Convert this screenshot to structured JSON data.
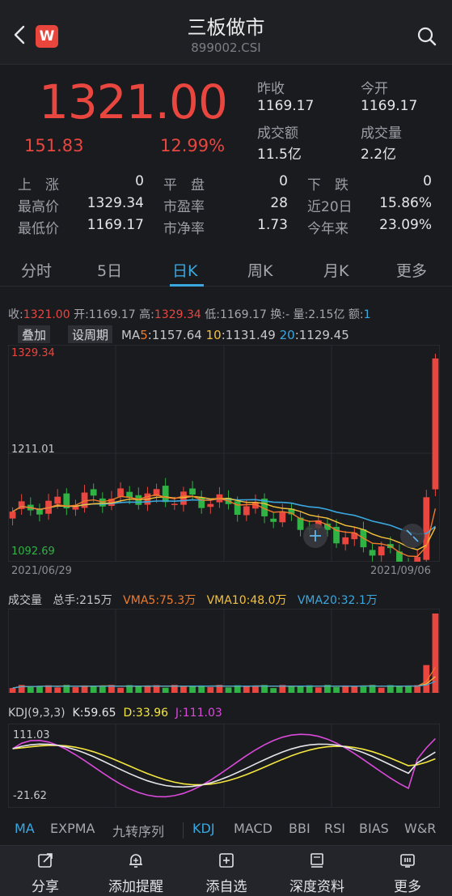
{
  "header": {
    "title": "三板做市",
    "code": "899002.CSI",
    "logo_letter": "W"
  },
  "quote": {
    "price": "1321.00",
    "change": "151.83",
    "change_pct": "12.99%",
    "prev_close_label": "昨收",
    "prev_close": "1169.17",
    "open_label": "今开",
    "open": "1169.17",
    "turnover_label": "成交额",
    "turnover": "11.5亿",
    "volume_label": "成交量",
    "volume": "2.2亿"
  },
  "stats": {
    "up_label": "上　涨",
    "up": "0",
    "flat_label": "平　盘",
    "flat": "0",
    "down_label": "下　跌",
    "down": "0",
    "high_label": "最高价",
    "high": "1329.34",
    "pe_label": "市盈率",
    "pe": "28",
    "d20_label": "近20日",
    "d20": "15.86%",
    "low_label": "最低价",
    "low": "1169.17",
    "pb_label": "市净率",
    "pb": "1.73",
    "ytd_label": "今年来",
    "ytd": "23.09%"
  },
  "tabs": [
    "分时",
    "5日",
    "日K",
    "周K",
    "月K",
    "更多"
  ],
  "active_tab": "日K",
  "candle_info": {
    "close_label": "收:",
    "close": "1321.00",
    "open_label": "开:",
    "open": "1169.17",
    "high_label": "高:",
    "high": "1329.34",
    "low_label": "低:",
    "low": "1169.17",
    "turnover_label": "换:",
    "turnover": "-",
    "vol_label": "量:",
    "vol": "2.15亿",
    "amount_label": "额:",
    "amount": "1"
  },
  "buttons": {
    "overlay": "叠加",
    "period": "设周期"
  },
  "ma": {
    "label": "MA",
    "p5": "5",
    "v5": ":1157.64",
    "p10": "10",
    "v10": ":1131.49",
    "p20": "20",
    "v20": ":1129.45"
  },
  "axis": {
    "top": "1329.34",
    "mid": "1211.01",
    "bottom": "1092.69"
  },
  "dates": {
    "start": "2021/06/29",
    "end": "2021/09/06"
  },
  "volume_panel": {
    "title": "成交量",
    "total": "总手:215万",
    "vma5": "VMA5:75.3万",
    "vma10": "VMA10:48.0万",
    "vma20": "VMA20:32.1万"
  },
  "kdj": {
    "title": "KDJ(9,3,3)",
    "k": "K:59.65",
    "d": "D:33.96",
    "j": "J:111.03",
    "axis_top": "111.03",
    "axis_bottom": "-21.62"
  },
  "indicators": [
    "MA",
    "EXPMA",
    "九转序列",
    "KDJ",
    "MACD",
    "BBI",
    "RSI",
    "BIAS",
    "W&R"
  ],
  "active_indicators": [
    "MA",
    "KDJ"
  ],
  "bottom_nav": [
    {
      "label": "分享",
      "icon": "share-icon"
    },
    {
      "label": "添加提醒",
      "icon": "alert-icon"
    },
    {
      "label": "添自选",
      "icon": "add-watchlist-icon"
    },
    {
      "label": "深度资料",
      "icon": "book-icon"
    },
    {
      "label": "更多",
      "icon": "more-icon"
    }
  ],
  "colors": {
    "up": "#e8463f",
    "down": "#2fb344",
    "accent": "#3aa8e0",
    "ma5": "#f07a2a",
    "ma10": "#f5c13b",
    "ma20": "#3aa8e0",
    "k": "#e6e6ea",
    "d": "#f5e740",
    "j": "#d94ad9"
  }
}
